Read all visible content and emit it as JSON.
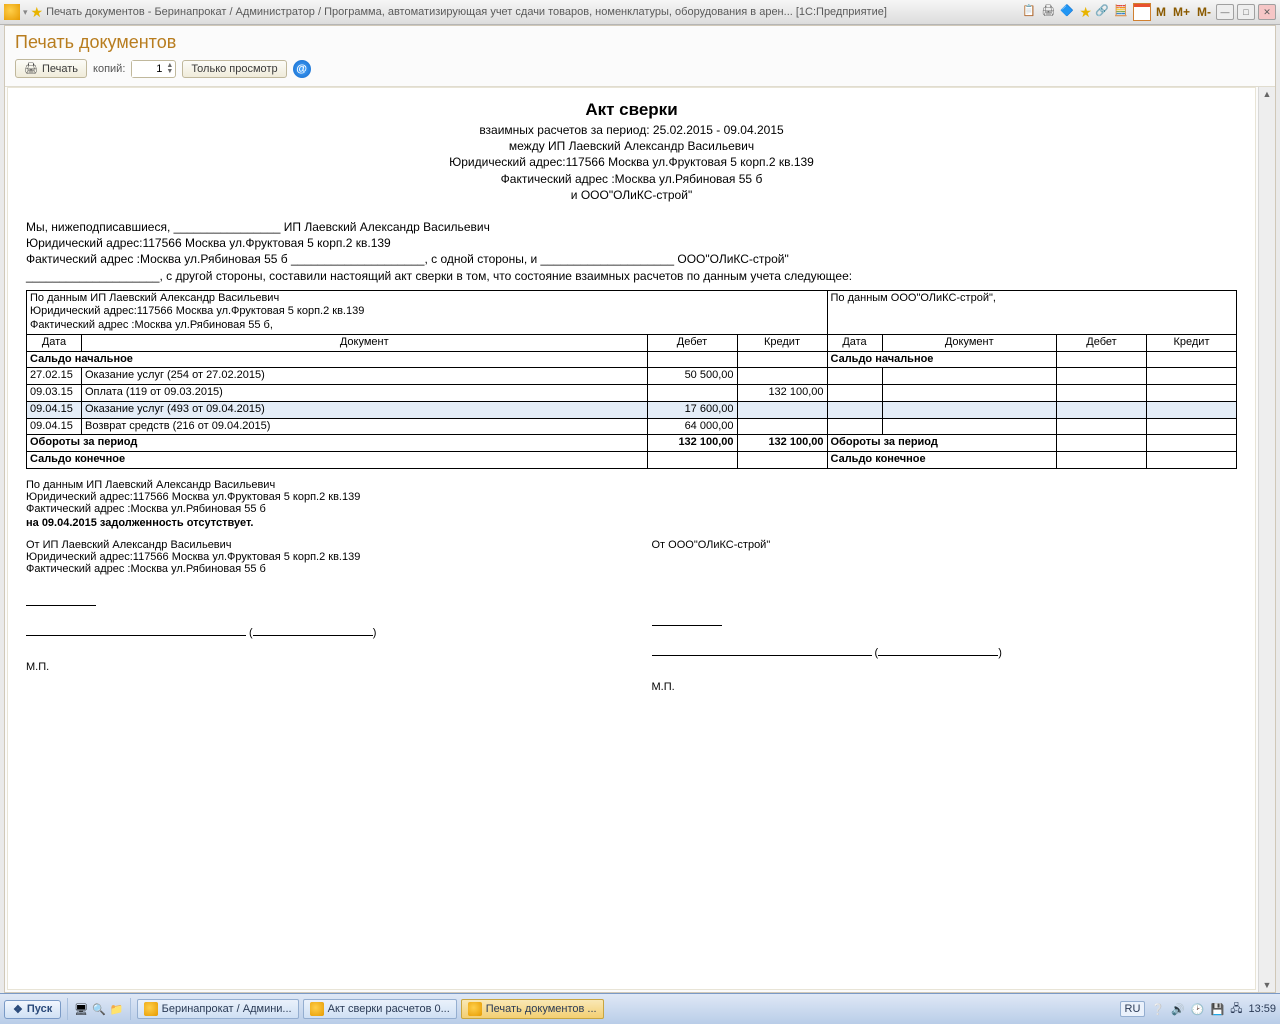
{
  "titlebar": {
    "title": "Печать документов - Беринапрокат / Администратор / Программа, автоматизирующая учет сдачи товаров, номенклатуры, оборудования в арен...   [1С:Предприятие]",
    "m": "M",
    "mplus": "M+",
    "mminus": "M-"
  },
  "page": {
    "title": "Печать документов"
  },
  "toolbar": {
    "print": "Печать",
    "copies_label": "копий:",
    "copies_value": "1",
    "preview": "Только просмотр"
  },
  "doc": {
    "h1": "Акт сверки",
    "c1": "взаимных расчетов за период: 25.02.2015 - 09.04.2015",
    "c2": "между ИП Лаевский Александр Васильевич",
    "c3": "Юридический адрес:117566 Москва ул.Фруктовая 5 корп.2 кв.139",
    "c4": "Фактический адрес :Москва ул.Рябиновая 55 б",
    "c5": "и ООО\"ОЛиКС-строй\"",
    "para": "Мы, нижеподписавшиеся, ________________ ИП Лаевский Александр Васильевич\nЮридический адрес:117566 Москва ул.Фруктовая 5 корп.2 кв.139\nФактический адрес :Москва ул.Рябиновая 55 б ____________________, с одной стороны, и ____________________ ООО\"ОЛиКС-строй\"\n____________________, с другой стороны, составили настоящий акт сверки в том, что состояние взаимных расчетов по данным учета следующее:",
    "head_left": "По данным ИП Лаевский Александр Васильевич\nЮридический адрес:117566 Москва ул.Фруктовая 5 корп.2 кв.139\nФактический адрес :Москва ул.Рябиновая 55 б,",
    "head_right": "По данным ООО\"ОЛиКС-строй\",",
    "cols": {
      "date": "Дата",
      "doc": "Документ",
      "debit": "Дебет",
      "credit": "Кредит"
    },
    "saldo_start": "Сальдо начальное",
    "rows": [
      {
        "date": "27.02.15",
        "doc": "Оказание услуг (254 от 27.02.2015)",
        "debit": "50 500,00",
        "credit": ""
      },
      {
        "date": "09.03.15",
        "doc": "Оплата (119 от 09.03.2015)",
        "debit": "",
        "credit": "132 100,00"
      },
      {
        "date": "09.04.15",
        "doc": "Оказание услуг (493 от 09.04.2015)",
        "debit": "17 600,00",
        "credit": "",
        "sel": true
      },
      {
        "date": "09.04.15",
        "doc": "Возврат средств (216 от 09.04.2015)",
        "debit": "64 000,00",
        "credit": ""
      }
    ],
    "turnover_label": "Обороты за период",
    "turnover_debit": "132 100,00",
    "turnover_credit": "132 100,00",
    "saldo_end": "Сальдо конечное",
    "after1": "По данным ИП Лаевский Александр Васильевич\nЮридический адрес:117566 Москва ул.Фруктовая 5 корп.2 кв.139\nФактический адрес :Москва ул.Рябиновая 55 б",
    "after_bold": "на 09.04.2015 задолженность отсутствует.",
    "sig_left_from": "От ИП Лаевский Александр Васильевич\nЮридический адрес:117566 Москва ул.Фруктовая 5 корп.2 кв.139\nФактический адрес :Москва ул.Рябиновая 55 б",
    "sig_right_from": "От ООО\"ОЛиКС-строй\"",
    "mp": "М.П."
  },
  "taskbar": {
    "start": "Пуск",
    "items": [
      {
        "label": "Беринапрокат / Админи..."
      },
      {
        "label": "Акт сверки расчетов 0..."
      },
      {
        "label": "Печать документов ...",
        "active": true
      }
    ],
    "lang": "RU",
    "time": "13:59"
  }
}
